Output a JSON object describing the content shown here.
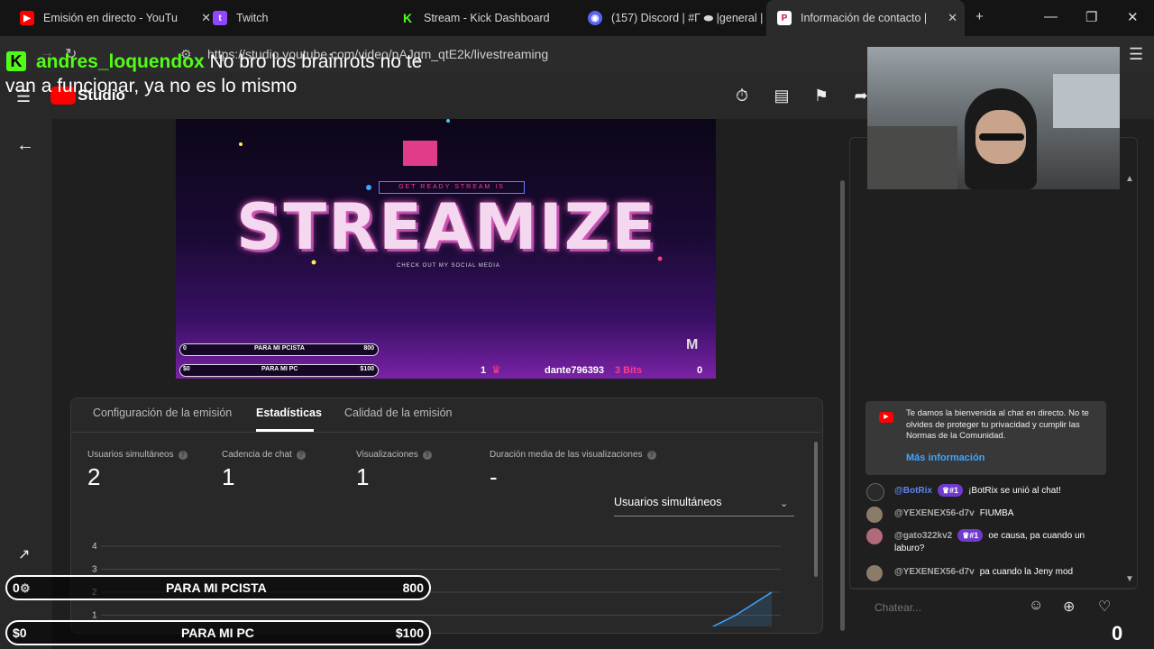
{
  "browser": {
    "tabs": [
      {
        "title": "Emisión en directo - YouTu",
        "icon": "youtube-icon",
        "active": false
      },
      {
        "title": "Twitch",
        "icon": "twitch-icon",
        "active": false
      },
      {
        "title": "Stream - Kick Dashboard",
        "icon": "kick-icon",
        "active": false
      },
      {
        "title": "(157) Discord | #Γ ⬬ |general |",
        "icon": "discord-icon",
        "active": false,
        "badge": "157"
      },
      {
        "title": "Información de contacto |",
        "icon": "p-icon",
        "active": true
      }
    ],
    "url": "https://studio.youtube.com/video/pAJgm_qtE2k/livestreaming"
  },
  "studio": {
    "logo_text": "Studio"
  },
  "preview": {
    "banner": "GET READY STREAM IS",
    "logo_text": "STREAMIZE",
    "check": "CHECK OUT MY SOCIAL MEDIA",
    "goal1_left": "0",
    "goal1_label": "PARA MI PCISTA",
    "goal1_right": "800",
    "goal2_left": "$0",
    "goal2_label": "PARA MI PC",
    "goal2_right": "$100",
    "count": "1",
    "donor": "dante796393",
    "bits": "3 Bits",
    "right_count": "0"
  },
  "stats": {
    "tabs": [
      "Configuración de la emisión",
      "Estadísticas",
      "Calidad de la emisión"
    ],
    "metrics": [
      {
        "label": "Usuarios simultáneos",
        "value": "2"
      },
      {
        "label": "Cadencia de chat",
        "value": "1"
      },
      {
        "label": "Visualizaciones",
        "value": "1"
      },
      {
        "label": "Duración media de las visualizaciones",
        "value": "-"
      }
    ],
    "select_value": "Usuarios simultáneos"
  },
  "chart_data": {
    "type": "line",
    "title": "",
    "xlabel": "",
    "ylabel": "",
    "y_ticks": [
      "4",
      "3",
      "2",
      "1"
    ],
    "ylim": [
      0,
      4
    ],
    "series": [
      {
        "values": [
          1,
          1,
          2
        ]
      }
    ]
  },
  "chat": {
    "welcome_text": "Te damos la bienvenida al chat en directo. No te olvides de proteger tu privacidad y cumplir las Normas de la Comunidad.",
    "welcome_link": "Más información",
    "messages": [
      {
        "author": "@BotRix",
        "badge": "#1",
        "text": "¡BotRix se unió al chat!"
      },
      {
        "author": "@YEXENEX56-d7v",
        "badge": "",
        "text": "FIUMBA"
      },
      {
        "author": "@gato322kv2",
        "badge": "#1",
        "text": "oe causa, pa cuando un laburo?"
      },
      {
        "author": "@YEXENEX56-d7v",
        "badge": "",
        "text": "pa cuando la Jeny mod"
      }
    ],
    "input_placeholder": "Chatear..."
  },
  "overlay": {
    "chat_user": "andres_loquendox",
    "chat_text1": " No bro los brainrots no te",
    "chat_text2": "van a funcionar, ya no es lo mismo",
    "bar1_left": "0",
    "bar1_label": "PARA MI PCISTA",
    "bar1_right": "800",
    "bar2_left": "$0",
    "bar2_label": "PARA MI PC",
    "bar2_right": "$100",
    "corner_count": "0"
  },
  "colors": {
    "kick_green": "#53fc18",
    "yt_red": "#ff0000",
    "link_blue": "#3ea6ff",
    "badge_purple": "#6f3bcc"
  }
}
